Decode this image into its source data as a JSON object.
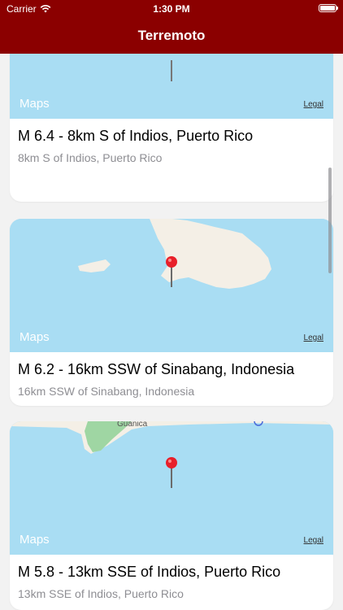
{
  "status": {
    "carrier": "Carrier",
    "time": "1:30 PM"
  },
  "nav": {
    "title": "Terremoto"
  },
  "map": {
    "logo": "Maps",
    "legal": "Legal"
  },
  "quakes": [
    {
      "title": "M 6.4 - 8km S of Indios, Puerto Rico",
      "subtitle": "8km S of Indios, Puerto Rico"
    },
    {
      "title": "M 6.2 - 16km SSW of Sinabang, Indonesia",
      "subtitle": "16km SSW of Sinabang, Indonesia"
    },
    {
      "title": "M 5.8 - 13km SSE of Indios, Puerto Rico",
      "subtitle": "13km SSE of Indios, Puerto Rico",
      "map_place_label": "Guánica"
    }
  ],
  "colors": {
    "accent": "#8b0000",
    "water": "#a9ddf3",
    "land": "#f4efe6",
    "park": "#9fd6a3",
    "pin": "#e8202a"
  }
}
